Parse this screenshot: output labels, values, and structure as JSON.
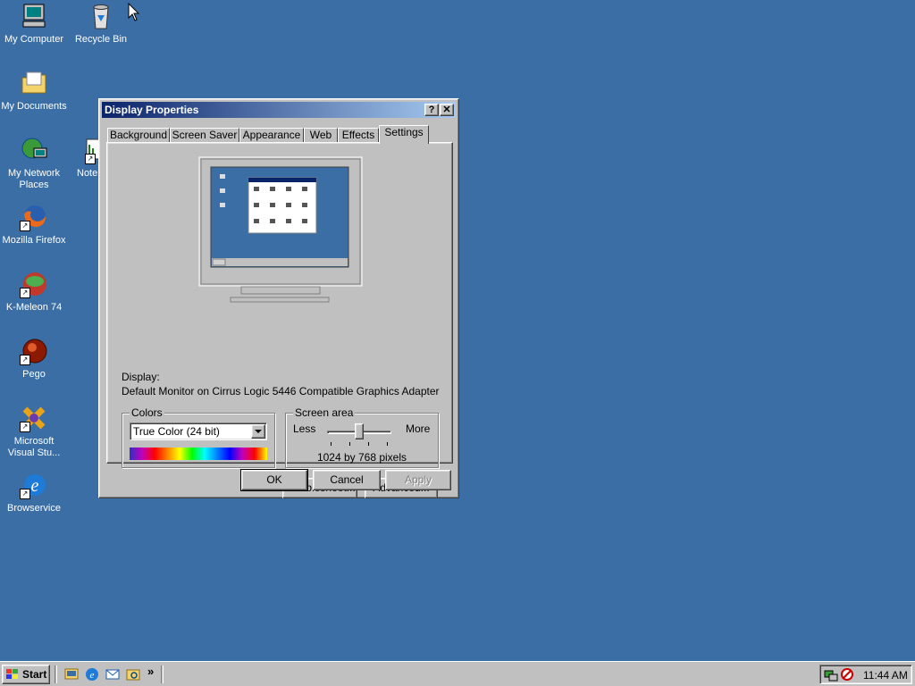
{
  "desktop": {
    "icons": [
      {
        "label": "My Computer",
        "icon": "computer-icon"
      },
      {
        "label": "Recycle Bin",
        "icon": "recycle-bin-icon"
      },
      {
        "label": "My Documents",
        "icon": "folder-icon"
      },
      {
        "label": "My Network Places",
        "icon": "network-icon"
      },
      {
        "label": "Mozilla Firefox",
        "icon": "firefox-icon"
      },
      {
        "label": "K-Meleon 74",
        "icon": "kmeleon-icon"
      },
      {
        "label": "Pego",
        "icon": "pego-icon"
      },
      {
        "label": "Microsoft Visual Stu...",
        "icon": "visual-studio-icon"
      },
      {
        "label": "Browservice",
        "icon": "ie-icon"
      },
      {
        "label": "Note",
        "icon": "notepad-icon"
      }
    ]
  },
  "dialog": {
    "title": "Display Properties",
    "help": "?",
    "close": "✕",
    "tabs": [
      "Background",
      "Screen Saver",
      "Appearance",
      "Web",
      "Effects",
      "Settings"
    ],
    "active_tab": "Settings",
    "display_label": "Display:",
    "display_value": "Default Monitor on Cirrus Logic 5446 Compatible Graphics Adapter",
    "colors": {
      "title": "Colors",
      "selected": "True Color (24 bit)"
    },
    "screen_area": {
      "title": "Screen area",
      "less": "Less",
      "more": "More",
      "value": "1024 by 768 pixels",
      "slider_level": 0.5
    },
    "buttons": {
      "troubleshoot": "Troubleshoot...",
      "advanced": "Advanced...",
      "ok": "OK",
      "cancel": "Cancel",
      "apply": "Apply"
    }
  },
  "taskbar": {
    "start": "Start",
    "clock": "11:44 AM",
    "more": "»"
  },
  "colors": {
    "desktop": "#3a6ea5",
    "title_start": "#0a246a",
    "title_end": "#a6caf0",
    "face": "#c0c0c0"
  }
}
